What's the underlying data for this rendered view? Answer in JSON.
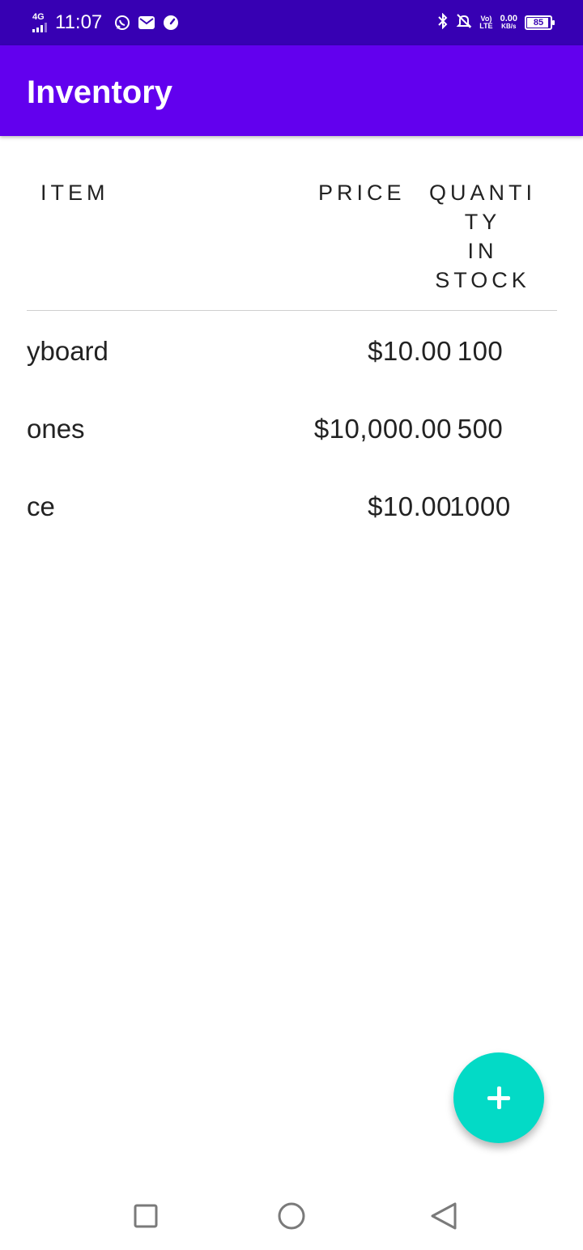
{
  "status_bar": {
    "network": "4G",
    "time": "11:07",
    "volte_top": "Vo)",
    "volte_bottom": "LTE",
    "speed_value": "0.00",
    "speed_unit": "KB/s",
    "battery_level": "85",
    "icons": [
      "signal-icon",
      "whatsapp-icon",
      "mail-icon",
      "speed-meter-icon",
      "bluetooth-icon",
      "notifications-off-icon",
      "volte-icon",
      "battery-icon"
    ]
  },
  "app_bar": {
    "title": "Inventory"
  },
  "table": {
    "headers": {
      "item": "ITEM",
      "price": "PRICE",
      "quantity": "QUANTI\nTY\nIN\nSTOCK"
    },
    "rows": [
      {
        "item": "yboard",
        "price": "$10.00",
        "quantity": "100"
      },
      {
        "item": "ones",
        "price": "$10,000.00",
        "quantity": "500"
      },
      {
        "item": "ce",
        "price": "$10.00",
        "quantity": "1000"
      }
    ]
  },
  "fab": {
    "icon": "plus-icon",
    "color": "#03dac6"
  },
  "nav_bar": {
    "icons": [
      "recents-square-icon",
      "home-circle-icon",
      "back-triangle-icon"
    ]
  },
  "colors": {
    "status_bar": "#3700b3",
    "app_bar": "#6200ee",
    "accent": "#03dac6"
  }
}
